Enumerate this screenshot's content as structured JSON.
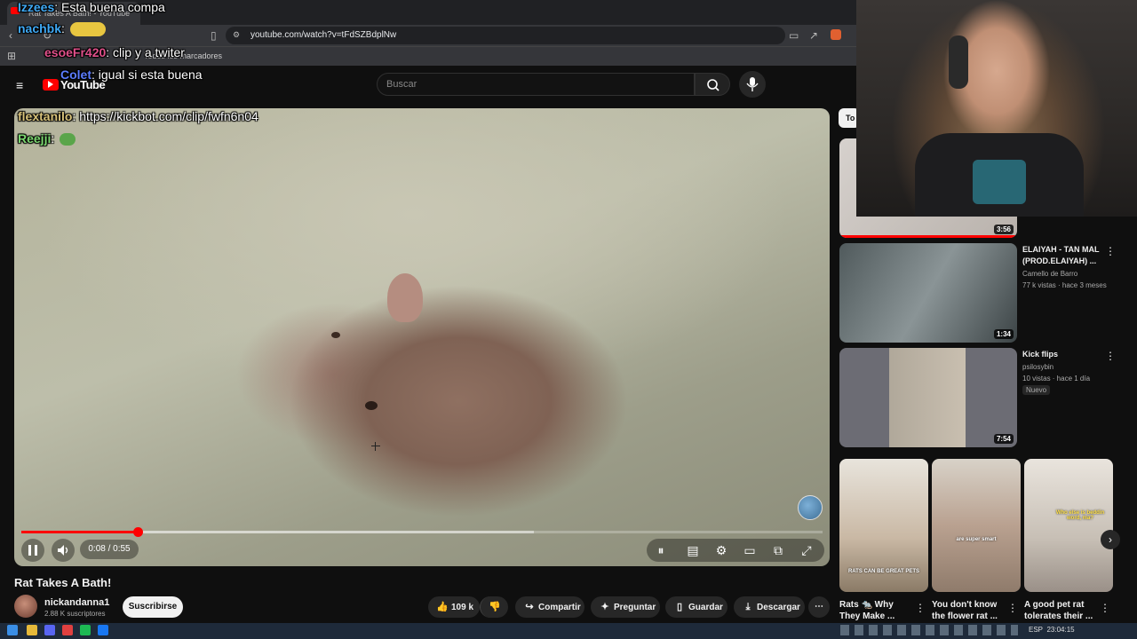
{
  "browser": {
    "tab_title": "Rat Takes A Bath! - YouTube",
    "url": "youtube.com/watch?v=tFdSZBdplNw",
    "bookmark_label": "Todos los marcadores"
  },
  "youtube": {
    "logo_text": "YouTube",
    "search_placeholder": "Buscar",
    "sidebar_chip": "To"
  },
  "video": {
    "title": "Rat Takes A Bath!",
    "time_display": "0:08 / 0:55",
    "progress_fraction": 0.145,
    "buffer_fraction": 0.64
  },
  "channel": {
    "name": "nickandanna1",
    "subscribers": "2.88 K suscriptores",
    "subscribe_label": "Suscribirse"
  },
  "actions": {
    "likes": "109 k",
    "share": "Compartir",
    "ask": "Preguntar",
    "save": "Guardar",
    "download": "Descargar"
  },
  "chat": [
    {
      "user": "Izzees",
      "color": "#3fa9f5",
      "message": ": Esta buena compa"
    },
    {
      "user": "nachbk",
      "color": "#3fa9f5",
      "message": ":"
    },
    {
      "user": "esoeFr420",
      "color": "#e0508a",
      "message": ": clip y a twiter"
    },
    {
      "user": "Colet",
      "color": "#5b7cff",
      "message": ": igual si esta buena"
    },
    {
      "user": "flextanilo",
      "color": "#d8c27a",
      "message": ": https://kickbot.com/clip/fwfn6n04"
    },
    {
      "user": "Reejji",
      "color": "#7cd870",
      "message": ":"
    }
  ],
  "recommendations": [
    {
      "title": "ELAIYAH - TAN MAL (PROD.ELAIYAH) ...",
      "channel": "Camello de Barro",
      "meta": "77 k vistas · hace 3 meses",
      "duration": "1:34"
    },
    {
      "title": "Kick flips",
      "channel": "psilosybin",
      "meta": "10 vistas · hace 1 día",
      "badge": "Nuevo",
      "duration": "7:54"
    }
  ],
  "first_thumb_duration": "3:56",
  "shorts": [
    {
      "title": "Rats 🐀 Why They Make ...",
      "overlay": "RATS CAN BE GREAT PETS"
    },
    {
      "title": "You don't know the flower rat ...",
      "overlay": "are super smart"
    },
    {
      "title": "A good pet rat tolerates their ...",
      "overlay": "Who else is beddin word, ma?"
    }
  ],
  "taskbar": {
    "lang": "ESP",
    "clock": "23:04:15"
  },
  "colors": {
    "accent": "#ff0000",
    "background": "#0f0f0f"
  }
}
